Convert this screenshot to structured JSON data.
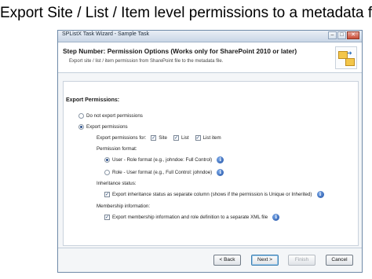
{
  "slide": {
    "title": "Export Site / List / Item level permissions to a metadata file"
  },
  "window": {
    "title": "SPListX Task Wizard - Sample Task",
    "controls": {
      "minimize": "–",
      "maximize": "□",
      "close": "✕"
    }
  },
  "header": {
    "step_title": "Step Number: Permission Options (Works only for SharePoint 2010 or later)",
    "step_desc": "Export site / list / item permission from SharePoint file to the metadata file.",
    "icon": "export-folders-icon"
  },
  "export": {
    "section_label": "Export Permissions:",
    "do_not_export": {
      "label": "Do not export permissions",
      "selected": false
    },
    "export_permissions": {
      "label": "Export permissions",
      "selected": true
    },
    "permissions_for": {
      "label": "Export permissions for:",
      "items": [
        {
          "label": "Site",
          "checked": true
        },
        {
          "label": "List",
          "checked": true
        },
        {
          "label": "List item",
          "checked": true
        }
      ]
    },
    "format": {
      "label": "Permission format:",
      "user_role": {
        "label": "User - Role format (e.g., johndoe: Full Control)",
        "selected": true
      },
      "role_user": {
        "label": "Role - User format (e.g., Full Control: johndoe)",
        "selected": false
      }
    },
    "inheritance": {
      "label": "Inheritance status:",
      "option": {
        "label": "Export inheritance status as separate column (shows if the permission is Unique or Inherited)",
        "checked": true
      }
    },
    "membership": {
      "label": "Membership information:",
      "option": {
        "label": "Export membership information and role definition to a separate XML file",
        "checked": true
      }
    }
  },
  "buttons": {
    "back": "< Back",
    "next": "Next >",
    "finish": "Finish",
    "cancel": "Cancel"
  },
  "colors": {
    "accent": "#1e4fa3",
    "titlebar": "#c9d6e6"
  }
}
